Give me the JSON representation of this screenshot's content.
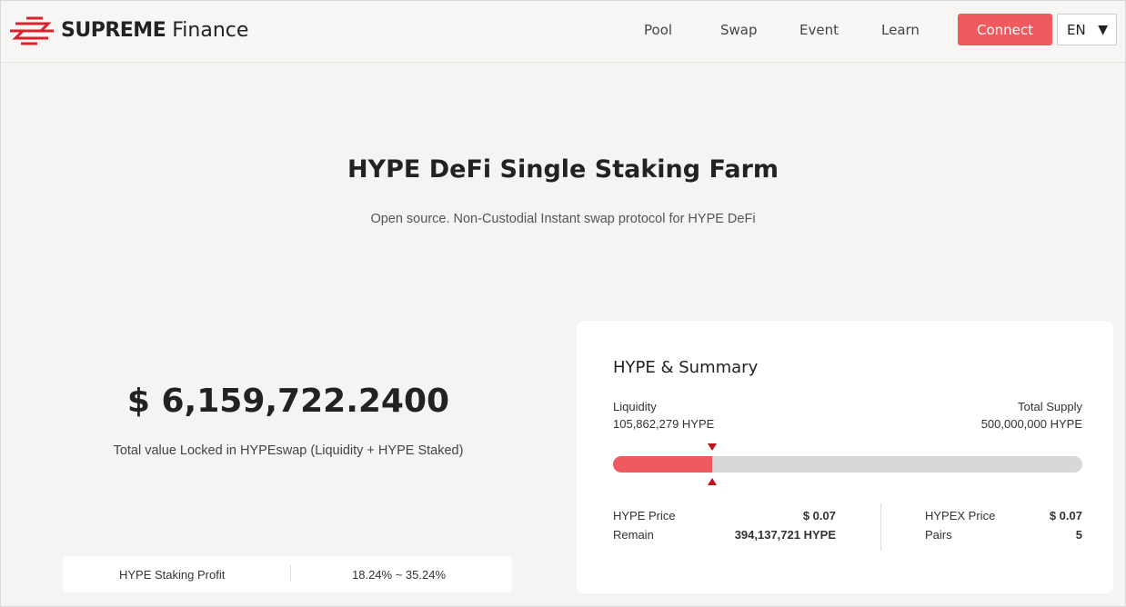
{
  "header": {
    "brand_bold": "SUPREME",
    "brand_light": "Finance",
    "nav": [
      "Pool",
      "Swap",
      "Event",
      "Learn"
    ],
    "connect_label": "Connect",
    "language": "EN",
    "accent_color": "#f05a5e"
  },
  "hero": {
    "title": "HYPE DeFi Single Staking Farm",
    "subtitle": "Open source. Non-Custodial Instant swap protocol for HYPE DeFi"
  },
  "tvl": {
    "value": "$ 6,159,722.2400",
    "label": "Total value Locked in HYPEswap (Liquidity + HYPE Staked)"
  },
  "staking_profit": {
    "label": "HYPE Staking Profit",
    "value": "18.24% ~ 35.24%"
  },
  "summary": {
    "title": "HYPE & Summary",
    "liquidity_label": "Liquidity",
    "liquidity_value": "105,862,279 HYPE",
    "total_supply_label": "Total Supply",
    "total_supply_value": "500,000,000 HYPE",
    "progress_fraction": 0.2117,
    "hype_price_label": "HYPE Price",
    "hype_price_value": "$ 0.07",
    "remain_label": "Remain",
    "remain_value": "394,137,721 HYPE",
    "hypex_price_label": "HYPEX Price",
    "hypex_price_value": "$ 0.07",
    "pairs_label": "Pairs",
    "pairs_value": "5"
  }
}
